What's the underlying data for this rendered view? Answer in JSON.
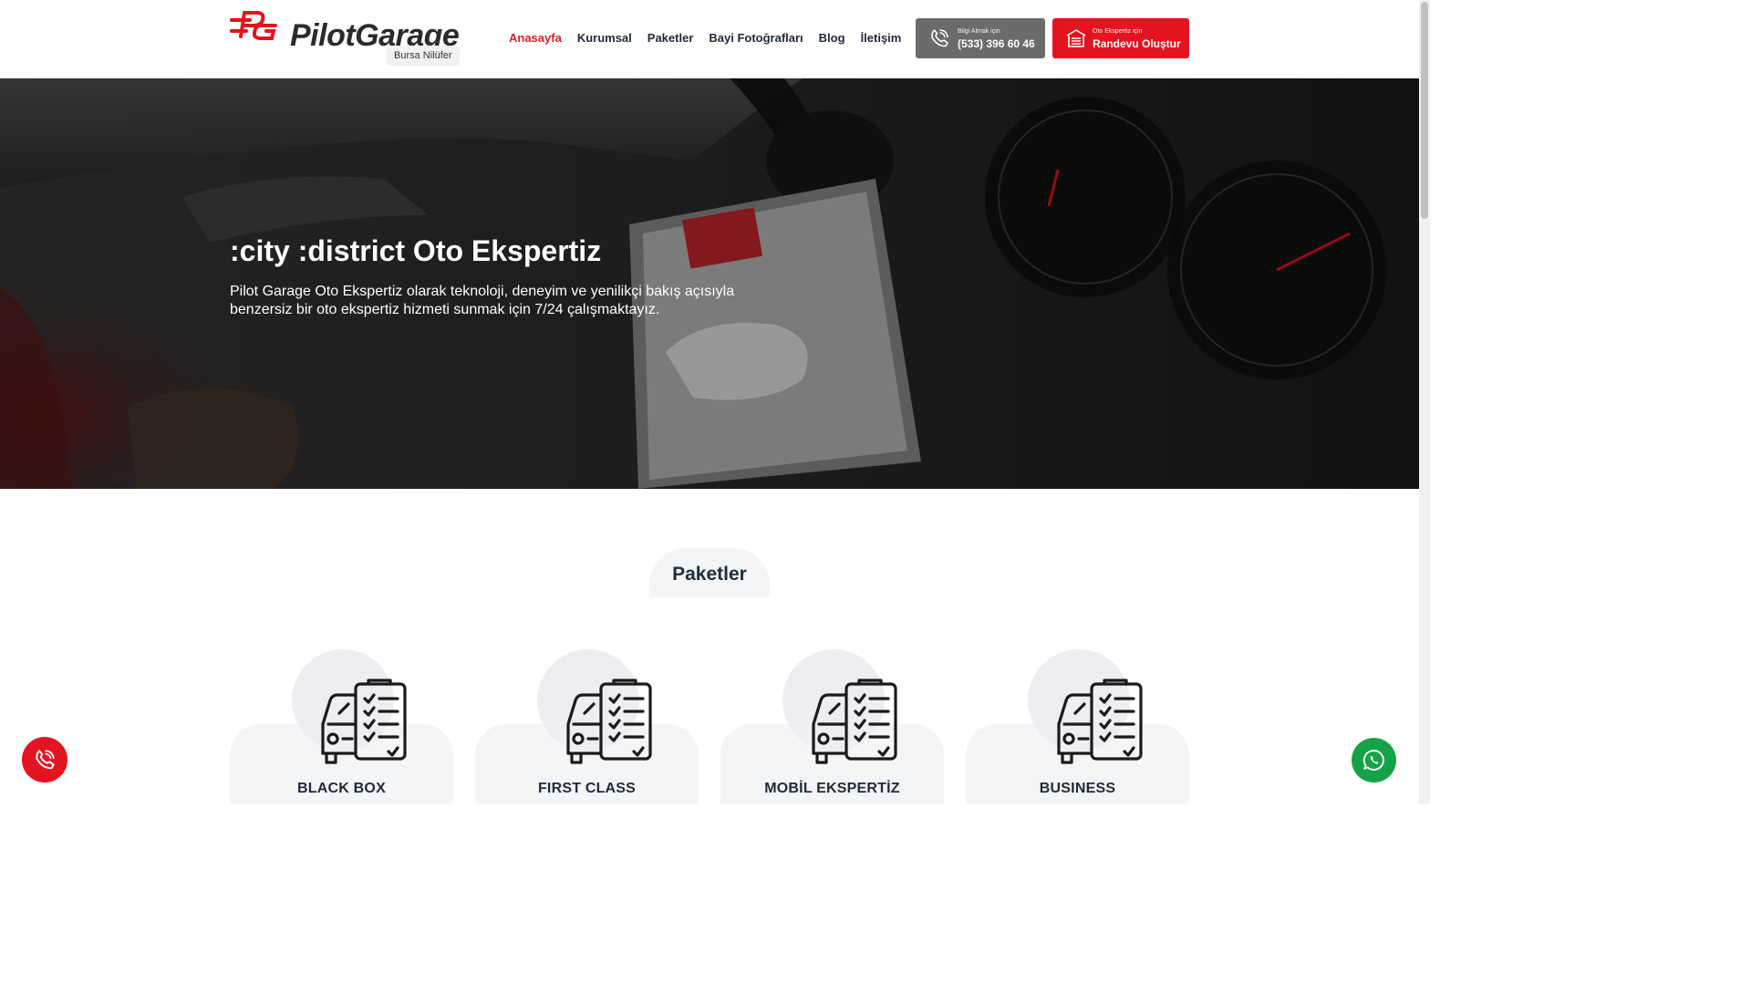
{
  "header": {
    "logo_text": "PilotGarage",
    "branch": "Bursa Nilüfer",
    "nav": [
      {
        "label": "Anasayfa",
        "active": true
      },
      {
        "label": "Kurumsal",
        "active": false
      },
      {
        "label": "Paketler",
        "active": false
      },
      {
        "label": "Bayi Fotoğrafları",
        "active": false
      },
      {
        "label": "Blog",
        "active": false
      },
      {
        "label": "İletişim",
        "active": false
      }
    ],
    "call_button": {
      "small": "Bilgi Almak için",
      "big": "(533) 396 60 46",
      "icon": "phone-icon"
    },
    "appointment_button": {
      "small": "Oto Ekspertiz için",
      "big": "Randevu Oluştur",
      "icon": "garage-icon"
    }
  },
  "hero": {
    "title": ":city :district Oto Ekspertiz",
    "description": "Pilot Garage Oto Ekspertiz olarak teknoloji, deneyim ve yenilikçi bakış açısıyla benzersiz bir oto ekspertiz hizmeti sunmak için 7/24 çalışmaktayız."
  },
  "packages": {
    "title": "Paketler",
    "items": [
      {
        "name": "BLACK BOX",
        "icon": "car-checklist-icon"
      },
      {
        "name": "FIRST CLASS",
        "icon": "car-checklist-icon"
      },
      {
        "name": "MOBİL EKSPERTİZ",
        "icon": "car-checklist-icon"
      },
      {
        "name": "BUSINESS",
        "icon": "car-checklist-icon"
      }
    ]
  },
  "floating": {
    "call_icon": "phone-icon",
    "whatsapp_icon": "whatsapp-icon"
  },
  "colors": {
    "brand_red": "#e3141f",
    "call_gray": "#6b6b6b",
    "whatsapp_green": "#17a24a",
    "text_dark": "#1f2937"
  }
}
